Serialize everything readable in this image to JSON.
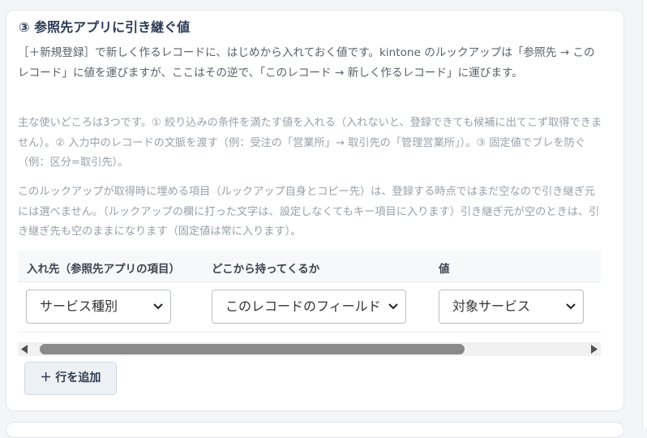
{
  "section": {
    "title": "③ 参照先アプリに引き継ぐ値",
    "intro": "［＋新規登録］で新しく作るレコードに、はじめから入れておく値です。kintone のルックアップは「参照先 → このレコード」に値を運びますが、ここはその逆で、「このレコード → 新しく作るレコード」に運びます。",
    "usage": "主な使いどころは3つです。① 絞り込みの条件を満たす値を入れる（入れないと、登録できても候補に出てこず取得できません）。② 入力中のレコードの文脈を渡す（例：受注の「営業所」→ 取引先の「管理営業所」）。③ 固定値でブレを防ぐ（例：区分=取引先）。",
    "note": "このルックアップが取得時に埋める項目（ルックアップ自身とコピー先）は、登録する時点ではまだ空なので引き継ぎ元には選べません。（ルックアップの欄に打った文字は、設定しなくてもキー項目に入ります）引き継ぎ元が空のときは、引き継ぎ先も空のままになります（固定値は常に入ります）。"
  },
  "table": {
    "headers": [
      "入れ先（参照先アプリの項目）",
      "どこから持ってくるか",
      "値"
    ],
    "rows": [
      {
        "target": "サービス種別",
        "source": "このレコードのフィールド",
        "value": "対象サービス"
      }
    ]
  },
  "add_row_label": "＋ 行を追加"
}
